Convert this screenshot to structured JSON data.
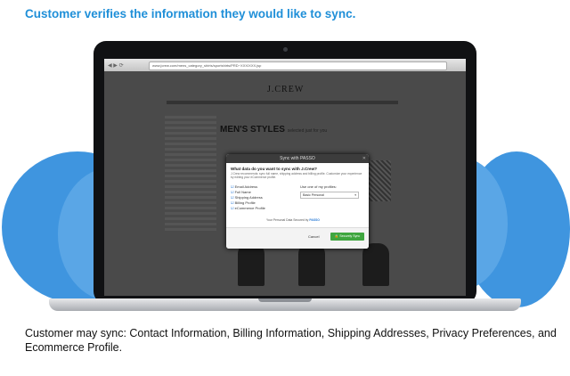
{
  "headline": "Customer verifies the information they would like to sync.",
  "caption": "Customer may sync: Contact Information, Billing Information, Shipping Addresses, Privacy Preferences, and Ecommerce Profile.",
  "browser": {
    "url": "www.jcrew.com/mens_category_shirts/sportshirts/PRD~XXX/XXX.jsp",
    "store_logo": "J.CREW",
    "section_title": "MEN'S STYLES",
    "section_subtitle": "selected just for you"
  },
  "dialog": {
    "title": "Sync with PASSO",
    "question": "What data do you want to sync with J.Crew?",
    "description": "J.Crew recommends: sync full name, shipping address and billing profile. Customize your experience by editing your eCommerce profile.",
    "options": [
      {
        "label": "Email Address",
        "checked": true
      },
      {
        "label": "Full Name",
        "checked": true
      },
      {
        "label": "Shipping Address",
        "checked": true
      },
      {
        "label": "Billing Profile",
        "checked": true
      },
      {
        "label": "eCommerce Profile",
        "checked": true
      }
    ],
    "profile_label": "Use one of my profiles:",
    "profile_selected": "Basic Personal",
    "secured_text": "Your Personal Data Secured by",
    "brand": "PASSO",
    "cancel_label": "Cancel",
    "sync_label": "Securely Sync"
  },
  "colors": {
    "headline": "#1f8fd8",
    "blob": "#3f95df",
    "sync_button": "#3fa63f"
  }
}
